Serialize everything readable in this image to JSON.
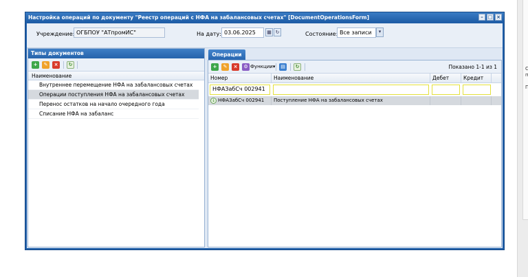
{
  "window": {
    "title": "Настройка операций по документу \"Реестр операций с НФА на забалансовых счетах\" [DocumentOperationsForm]"
  },
  "filters": {
    "institution_label": "Учреждение:",
    "institution_value": "ОГБПОУ \"АТпромИС\"",
    "date_label": "На дату:",
    "date_value": "03.06.2025",
    "state_label": "Состояние:",
    "state_value": "Все записи"
  },
  "left_panel": {
    "title": "Типы документов",
    "column": "Наименование",
    "items": [
      "Внутреннее перемещение НФА на забалансовых счетах",
      "Операции поступления НФА на забалансовых счетах",
      "Перенос остатков на начало очередного года",
      "Списание НФА на забаланс"
    ]
  },
  "right_panel": {
    "tab": "Операции",
    "functions_label": "Функции",
    "paging": "Показано 1-1 из 1",
    "columns": [
      "Номер",
      "Наименование",
      "Дебет",
      "Кредит"
    ],
    "filter_number": "НФАЗабСч 002941",
    "row": {
      "number": "НФАЗабСч 002941",
      "name": "Поступление НФА на забалансовых счетах",
      "debit": "",
      "credit": ""
    }
  },
  "background": {
    "side_letters": [
      "С",
      "п",
      "П"
    ]
  }
}
